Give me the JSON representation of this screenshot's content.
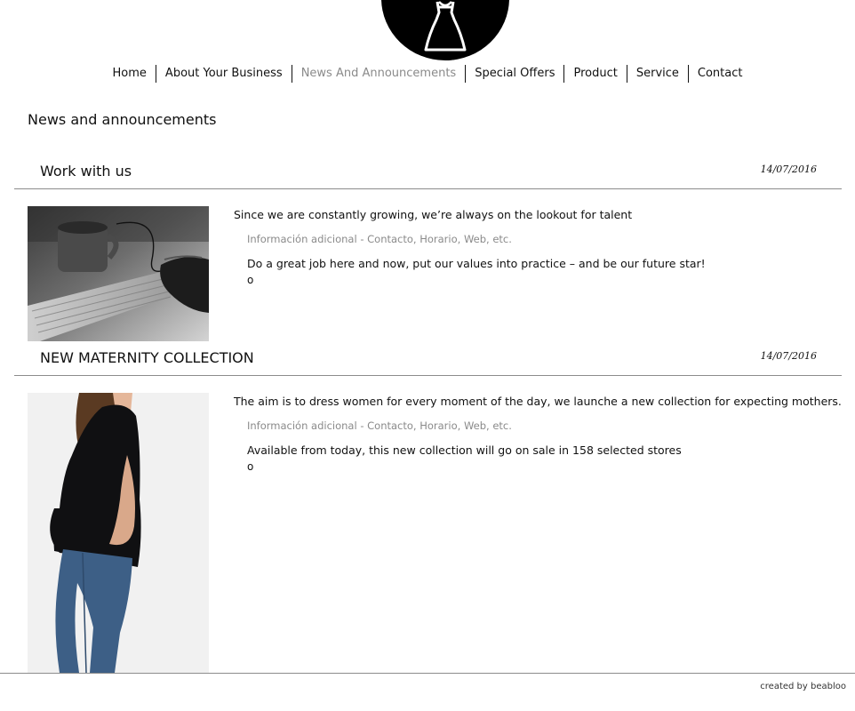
{
  "nav": {
    "items": [
      {
        "label": "Home"
      },
      {
        "label": "About Your Business"
      },
      {
        "label": "News And Announcements"
      },
      {
        "label": "Special Offers"
      },
      {
        "label": "Product"
      },
      {
        "label": "Service"
      },
      {
        "label": "Contact"
      }
    ],
    "active": "News And Announcements"
  },
  "page": {
    "title": "News and announcements"
  },
  "articles": [
    {
      "title": "Work with us",
      "date": "14/07/2016",
      "lead": "Since we are constantly growing, we’re always on the lookout for talent",
      "info": "Información adicional - Contacto, Horario, Web, etc.",
      "body": "Do a great job here and now, put our values into practice – and be our future star!",
      "bullet": "o"
    },
    {
      "title": "NEW MATERNITY COLLECTION",
      "date": "14/07/2016",
      "lead": "The aim is to dress women for every moment of the day, we launche a new collection for expecting mothers.",
      "info": "Información adicional - Contacto, Horario, Web, etc.",
      "body": "Available from today, this new collection will go on sale in 158 selected stores",
      "bullet": "o"
    }
  ],
  "footer": {
    "credit": "created by beabloo"
  },
  "colors": {
    "accent": "#000000",
    "muted": "#8a8a8a",
    "divider": "#8c8c8c"
  }
}
